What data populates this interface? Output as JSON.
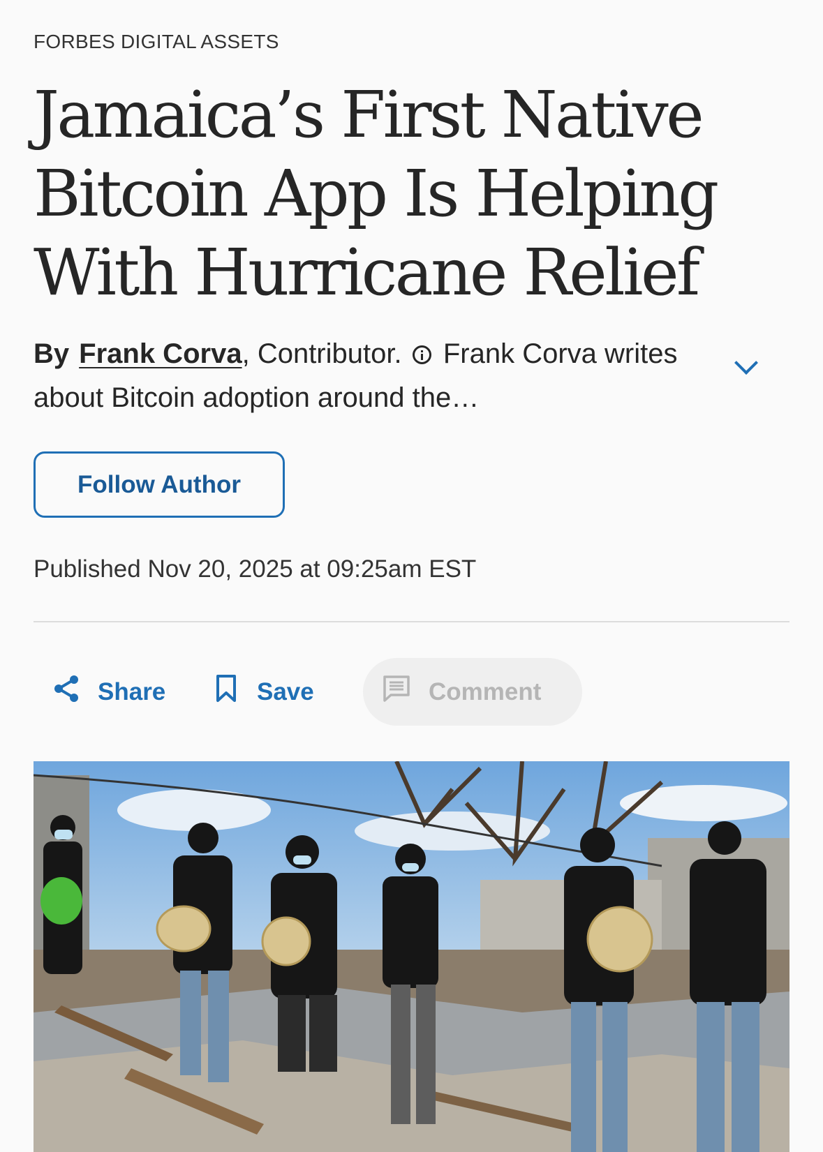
{
  "article": {
    "section": "FORBES DIGITAL ASSETS",
    "headline_lines": [
      "Jamaica’s First Native",
      "Bitcoin App Is Helping",
      "With Hurricane Relief"
    ],
    "byline": {
      "by": "By",
      "author_name": "Frank Corva",
      "comma": ",",
      "role": "Contributor.",
      "bio_snippet": "Frank Corva writes about Bitcoin adoption around the…"
    },
    "follow_label": "Follow Author",
    "published": "Published Nov 20, 2025 at 09:25am EST"
  },
  "actions": {
    "share_label": "Share",
    "save_label": "Save",
    "comment_label": "Comment"
  },
  "icons": {
    "info": "info-icon",
    "expand": "chevron-down-icon",
    "share": "share-icon",
    "save": "bookmark-icon",
    "comment": "comment-icon"
  },
  "colors": {
    "accent": "#1f6fb5",
    "text": "#262626",
    "muted": "#b5b5b5",
    "background": "#fafafa"
  },
  "hero_image": {
    "alt": "Volunteers handing out bags of supplies among hurricane debris"
  }
}
